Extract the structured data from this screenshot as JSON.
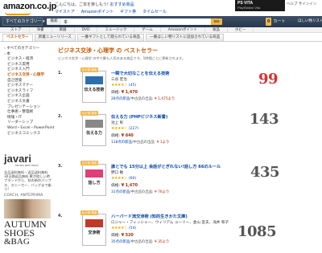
{
  "header": {
    "logo_text": "amazon",
    "logo_suffix": ".co.jp",
    "greeting": "こんにちは。ご本を楽しもう!",
    "greeting_link": "おすすめ商品",
    "nav": [
      "マイストア",
      "Amazonポイント",
      "ギフト券",
      "タイムセール"
    ],
    "promo_title": "PS VITA",
    "promo_sub": "PlayStation Vita",
    "links": "ヘルプ  サインイン"
  },
  "search": {
    "department": "すべてのカテゴリー",
    "label": "検索",
    "query": "本",
    "go_label": "GO",
    "cart_label": "カート",
    "cart_count": "0",
    "wishlist_label": "ほしい物リスト"
  },
  "category_nav": [
    "ストア",
    "洋書",
    "楽器",
    "DVD",
    "ミュージック",
    "ゲーム",
    "Amazonポイント",
    "食品",
    "ホビー"
  ],
  "tabs": [
    "ベストセラー",
    "新着ニューリリース",
    "一番ギフトとして贈られている商品",
    "一番ほしい物リストに追加されている商品"
  ],
  "sidebar": {
    "items": [
      {
        "label": "‹ すべてのカテゴリー",
        "level": "l1",
        "selected": false
      },
      {
        "label": "‹ 本",
        "level": "l1",
        "selected": false
      },
      {
        "label": "ビジネス・経済",
        "level": "l2",
        "selected": false
      },
      {
        "label": "ビジネス実用",
        "level": "l2",
        "selected": false
      },
      {
        "label": "ビジネス入門",
        "level": "l2",
        "selected": false
      },
      {
        "label": "ビジネス交渉・心理学",
        "level": "l2",
        "selected": true
      },
      {
        "label": "自己啓発",
        "level": "l2",
        "selected": false
      },
      {
        "label": "ビジネスマナー",
        "level": "l2",
        "selected": false
      },
      {
        "label": "ビジネスライフ",
        "level": "l2",
        "selected": false
      },
      {
        "label": "ビジネス企画",
        "level": "l2",
        "selected": false
      },
      {
        "label": "ビジネス文書",
        "level": "l2",
        "selected": false
      },
      {
        "label": "プレゼンテーション",
        "level": "l2",
        "selected": false
      },
      {
        "label": "仕事術・整理術",
        "level": "l2",
        "selected": false
      },
      {
        "label": "情報・IT",
        "level": "l2",
        "selected": false
      },
      {
        "label": "リーダーシップ",
        "level": "l2",
        "selected": false
      },
      {
        "label": "Word・Excel・PowerPoint",
        "level": "l2",
        "selected": false
      },
      {
        "label": "ビジネスコミックス",
        "level": "l2",
        "selected": false
      }
    ]
  },
  "ad": {
    "brand": "javari",
    "tagline": "shoes and more",
    "text": "全品送料無料・返品送料無料 30日間返品無料 靴が欲しい時ブランドから、秋の新作パンプス、スニーカー、バッグまで揃う!",
    "store": "COACH, ANTEPRIMA",
    "headline1": "AUTUMN",
    "headline2": "SHOES",
    "headline3": "&BAG"
  },
  "page": {
    "title": "ビジネス交渉・心理学 の ベストセラー",
    "description": "ビジネス交渉・心理学 の中で最も人気のある商品です。1時間ごとに更新されます。"
  },
  "products": [
    {
      "rank": "1.",
      "peek_label": "なか見!検索",
      "title": "一瞬で大切なことを伝える技術",
      "author": "三谷 宏治",
      "stars": "★★★★☆",
      "reviews": "(45)",
      "price_label": "価格:",
      "price": "¥ 1,470",
      "offers_count": "28点の新品",
      "offers_text": "/中古品の出品:",
      "offers_price": "¥ 1,475より",
      "annotation": "99",
      "annotation_color": "#d93030",
      "cover_title": "伝える技術",
      "cover_color": "#2a6fb0"
    },
    {
      "rank": "2.",
      "peek_label": "なか見!検索",
      "title": "伝える力 (PHPビジネス新書)",
      "author": "池上 彰",
      "stars": "★★★★☆",
      "reviews": "(227)",
      "price_label": "価格:",
      "price": "¥ 840",
      "offers_count": "118点の新品",
      "offers_text": "/中古品の出品:",
      "offers_price": "¥ 1より",
      "annotation": "143",
      "annotation_color": "#555555",
      "cover_title": "伝える力",
      "cover_color": "#888888"
    },
    {
      "rank": "3.",
      "peek_label": "なか見!検索",
      "title": "誰とでも 15分以上 会話がとぎれない!話し方 66のルール",
      "author": "野口 敏",
      "stars": "★★★★☆",
      "reviews": "(60)",
      "price_label": "価格:",
      "price": "¥ 1,470",
      "offers_count": "31点の新品",
      "offers_text": "/中古品の出品:",
      "offers_price": "¥ 76より",
      "annotation": "435",
      "annotation_color": "#555555",
      "cover_title": "話し方",
      "cover_color": "#e0407a"
    },
    {
      "rank": "4.",
      "peek_label": "なか見!検索",
      "title": "ハーバード流交渉術 (知的生きかた文庫)",
      "author": "ロジャー・フィッシャー、ウィリアム ユーリー、金山 宣夫、浅井 和子",
      "stars": "★★★★☆",
      "reviews": "(54)",
      "price_label": "価格:",
      "price": "¥ 520",
      "offers_count": "35点の新品",
      "offers_text": "/中古品の出品:",
      "offers_price": "¥ 35より",
      "annotation": "1085",
      "annotation_color": "#555555",
      "cover_title": "交渉術",
      "cover_color": "#c0392b"
    }
  ]
}
